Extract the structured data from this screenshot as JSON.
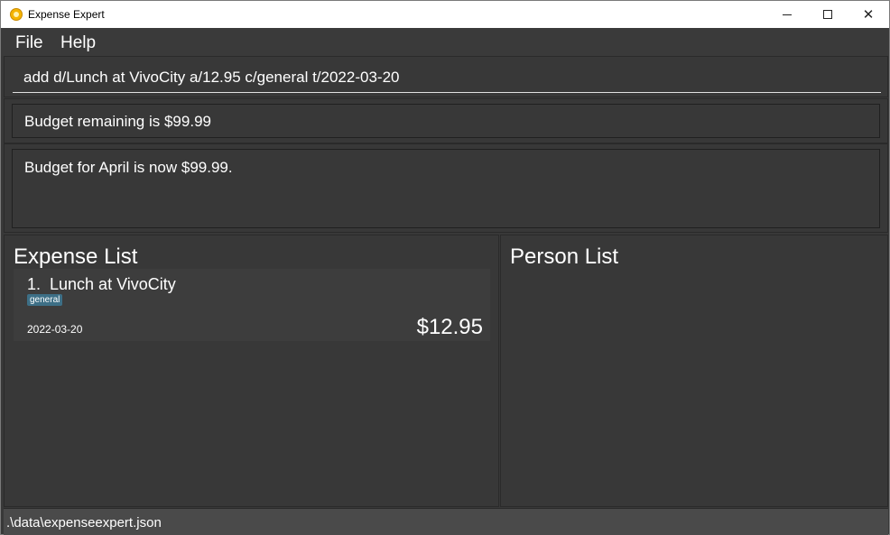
{
  "window": {
    "title": "Expense Expert"
  },
  "menu": {
    "file": "File",
    "help": "Help"
  },
  "command": {
    "value": "add d/Lunch at VivoCity a/12.95 c/general t/2022-03-20"
  },
  "budget": {
    "text": "Budget remaining is $99.99"
  },
  "result": {
    "text": "Budget for April is now $99.99."
  },
  "expense_list": {
    "title": "Expense List",
    "items": [
      {
        "index_desc": "1.  Lunch at VivoCity",
        "tag": "general",
        "date": "2022-03-20",
        "amount": "$12.95"
      }
    ]
  },
  "person_list": {
    "title": "Person List"
  },
  "status": {
    "path": ".\\data\\expenseexpert.json"
  },
  "colors": {
    "background": "#383838",
    "tag": "#3d6f86"
  },
  "icons": {
    "app": "app-coin-icon",
    "minimize": "minimize-icon",
    "maximize": "maximize-icon",
    "close": "close-icon"
  }
}
